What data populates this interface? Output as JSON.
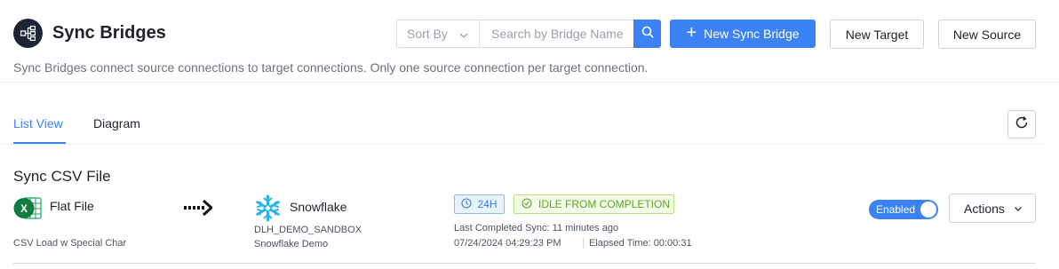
{
  "header": {
    "title": "Sync Bridges",
    "description": "Sync Bridges connect source connections to target connections. Only one source connection per target connection.",
    "icon": "bridge-network-icon"
  },
  "toolbar": {
    "sort_label": "Sort By",
    "search_placeholder": "Search by Bridge Name",
    "search_value": "",
    "new_bridge_label": "New Sync Bridge",
    "new_target_label": "New Target",
    "new_source_label": "New Source"
  },
  "tabs": [
    {
      "label": "List View",
      "active": true
    },
    {
      "label": "Diagram",
      "active": false
    }
  ],
  "bridges": [
    {
      "name": "Sync CSV File",
      "source": {
        "name": "Flat File",
        "description": "CSV Load w Special Char",
        "icon": "excel-icon"
      },
      "target": {
        "name": "Snowflake",
        "database": "DLH_DEMO_SANDBOX",
        "description": "Snowflake Demo",
        "icon": "snowflake-icon"
      },
      "frequency": "24H",
      "status": "IDLE FROM COMPLETION",
      "last_completed": "Last Completed Sync: 11 minutes ago",
      "sync_time": "07/24/2024 04:29:23 PM",
      "elapsed": "Elapsed Time: 00:00:31",
      "enabled_label": "Enabled",
      "enabled": true,
      "actions_label": "Actions"
    }
  ],
  "colors": {
    "accent": "#3b82f6",
    "success": "#5ba822",
    "header_icon_bg": "#1c2536"
  }
}
